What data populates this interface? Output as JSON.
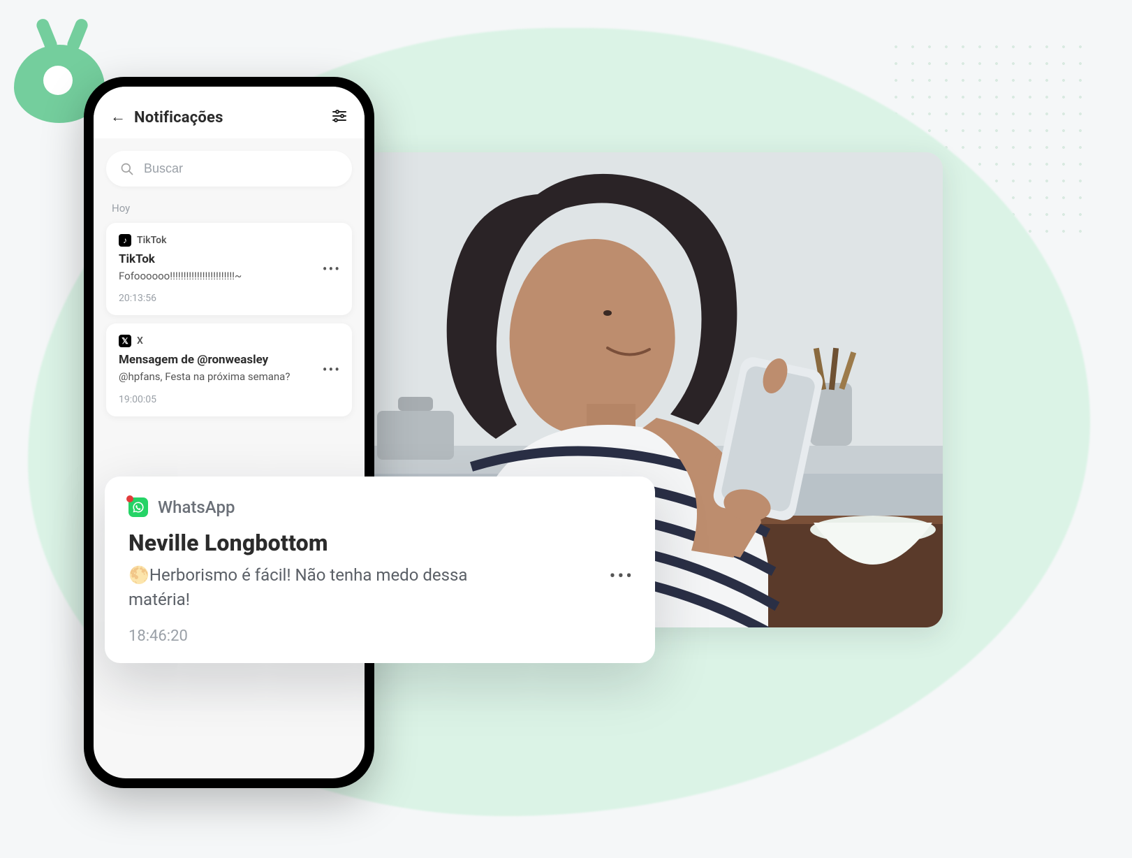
{
  "header": {
    "title": "Notificações"
  },
  "search": {
    "placeholder": "Buscar"
  },
  "section_label": "Hoy",
  "notifications": [
    {
      "app": "TikTok",
      "title": "TikTok",
      "body": "Fofoooooo!!!!!!!!!!!!!!!!!!!!!!!!~",
      "time": "20:13:56"
    },
    {
      "app": "X",
      "title": "Mensagem de @ronweasley",
      "body": "@hpfans, Festa na próxima semana?",
      "time": "19:00:05"
    }
  ],
  "highlight": {
    "app": "WhatsApp",
    "title": "Neville Longbottom",
    "body": "🌕Herborismo é fácil! Não tenha medo dessa matéria!",
    "time": "18:46:20"
  }
}
